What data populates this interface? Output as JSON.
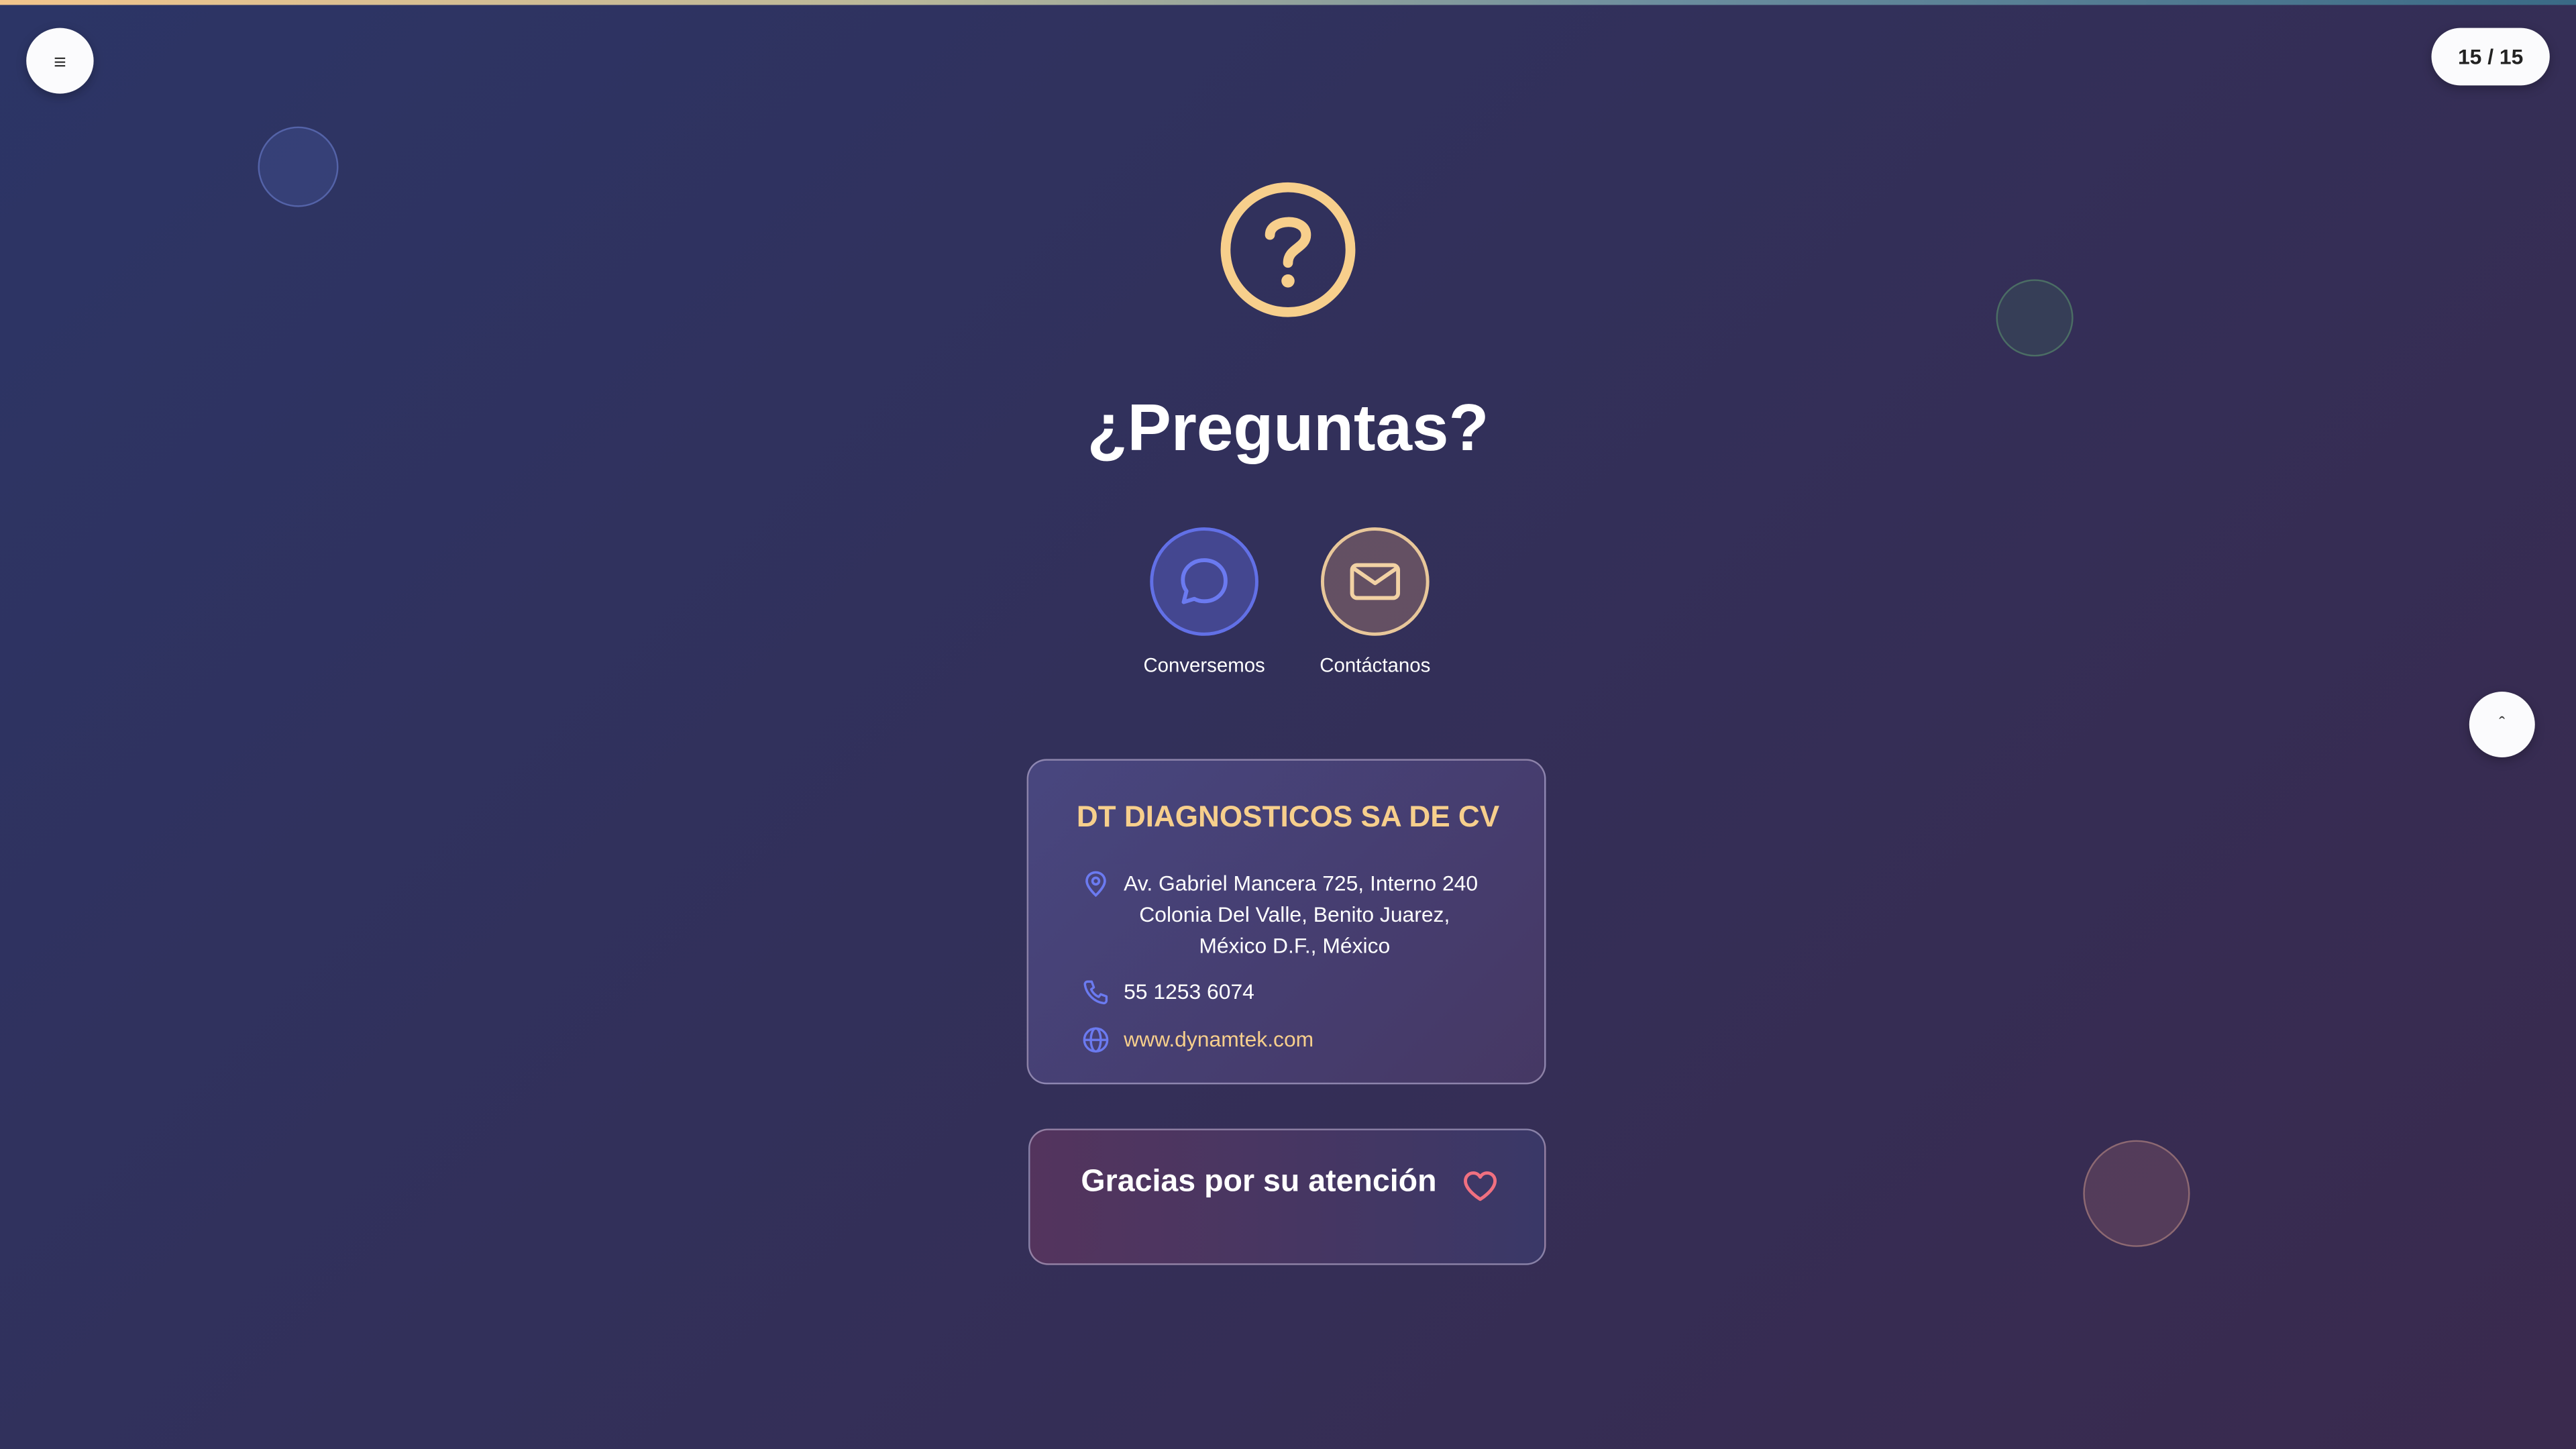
{
  "header": {
    "menu_glyph": "≡",
    "page_counter": "15 / 15"
  },
  "main": {
    "title": "¿Preguntas?",
    "actions": [
      {
        "label": "Conversemos",
        "icon": "chat-bubble-icon",
        "color": "#6270e6"
      },
      {
        "label": "Contáctanos",
        "icon": "mail-icon",
        "color": "#e8c79a"
      }
    ]
  },
  "company": {
    "name": "DT DIAGNOSTICOS SA DE CV",
    "address_line1": "Av. Gabriel Mancera 725, Interno 240",
    "address_line2": "Colonia Del Valle, Benito Juarez,",
    "address_line3": "México D.F., México",
    "phone": "55 1253 6074",
    "website": "www.dynamtek.com"
  },
  "thanks": {
    "text": "Gracias por su atención"
  },
  "scroll_top_glyph": "ˆ",
  "colors": {
    "accent_gold": "#f7cf8c",
    "accent_blue": "#6270e6",
    "heart_red": "#f07080"
  }
}
